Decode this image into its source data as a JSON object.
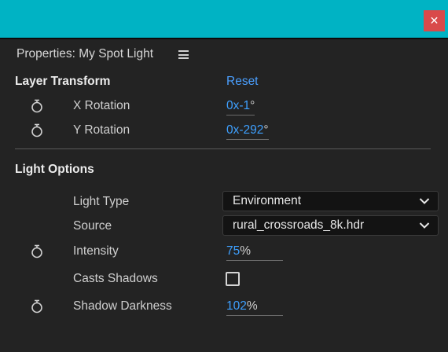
{
  "window": {
    "close_glyph": "✕"
  },
  "panel": {
    "title": "Properties: My Spot Light",
    "menu_icon": "hamburger-menu-icon"
  },
  "layer_transform": {
    "heading": "Layer Transform",
    "reset_label": "Reset",
    "x_rotation": {
      "label": "X Rotation",
      "value_turns": "0",
      "value_deg": "x-1",
      "unit": "°"
    },
    "y_rotation": {
      "label": "Y Rotation",
      "value_turns": "0",
      "value_deg": "x-292",
      "unit": "°"
    }
  },
  "light_options": {
    "heading": "Light Options",
    "light_type": {
      "label": "Light Type",
      "selected": "Environment"
    },
    "source": {
      "label": "Source",
      "selected": "rural_crossroads_8k.hdr"
    },
    "intensity": {
      "label": "Intensity",
      "value": "75",
      "unit": "%"
    },
    "casts_shadows": {
      "label": "Casts Shadows",
      "checked": false
    },
    "shadow_darkness": {
      "label": "Shadow Darkness",
      "value": "102",
      "unit": "%"
    }
  },
  "colors": {
    "accent": "#3ea0ff",
    "background": "#232323",
    "title_bar": "#00b3c4",
    "close": "#d94a4a"
  }
}
